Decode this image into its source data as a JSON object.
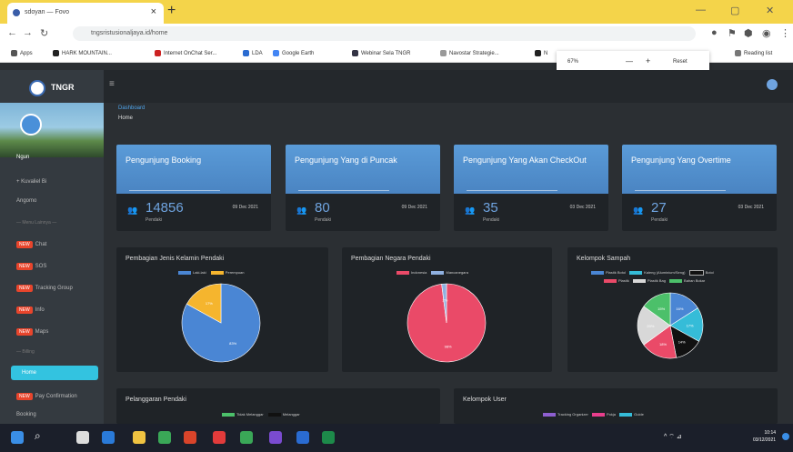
{
  "browser": {
    "tab_title": "sdoyan — Fovo",
    "url": "tngsristusionaljaya.id/home",
    "bookmarks": [
      "Apps",
      "HARK MOUNTAIN...",
      "Internet OnChat Ser...",
      "LDA",
      "Google Earth",
      "Webinar Sela TNGR",
      "Navostar Strategie...",
      "N"
    ],
    "zoom": {
      "value": "67%",
      "minus": "—",
      "plus": "+",
      "reset": "Reset"
    },
    "more_bookmarks": "Reading list"
  },
  "app": {
    "brand": "TNGR",
    "breadcrumb": [
      "Dashboard",
      "Home"
    ],
    "user": "Ngun",
    "sidebar": {
      "items": [
        {
          "label": "+ Kuvaliel Bi",
          "badge": ""
        },
        {
          "label": "Angomo",
          "badge": ""
        },
        {
          "label": "Chat",
          "badge": "NEW"
        },
        {
          "label": "SOS",
          "badge": "NEW"
        },
        {
          "label": "Tracking Group",
          "badge": "NEW"
        },
        {
          "label": "Info",
          "badge": "NEW"
        },
        {
          "label": "Maps",
          "badge": "NEW"
        }
      ],
      "header_1": "— Menu Lainnya —",
      "header_2": "— Billing",
      "active": "Home",
      "bottom_items": [
        {
          "label": "Pay Confirmation",
          "badge": "NEW"
        },
        {
          "label": "Booking",
          "badge": ""
        }
      ]
    },
    "cards": [
      {
        "title": "Pengunjung Booking",
        "value": "14856",
        "unit": "Pendaki",
        "date": "09 Dec 2021"
      },
      {
        "title": "Pengunjung Yang di Puncak",
        "value": "80",
        "unit": "Pendaki",
        "date": "09 Dec 2021"
      },
      {
        "title": "Pengunjung Yang Akan CheckOut",
        "value": "35",
        "unit": "Pendaki",
        "date": "03 Dec 2021"
      },
      {
        "title": "Pengunjung Yang Overtime",
        "value": "27",
        "unit": "Pendaki",
        "date": "03 Dec 2021"
      }
    ],
    "panels": {
      "gender": {
        "title": "Pembagian Jenis Kelamin Pendaki",
        "legend": [
          "Laki-laki",
          "Perempuan"
        ]
      },
      "country": {
        "title": "Pembagian Negara Pendaki",
        "legend": [
          "Indonesia",
          "Mancanegara"
        ]
      },
      "trash": {
        "title": "Kelompok Sampah",
        "legend": [
          "Plastik Botol",
          "Kaleng (Aluminium/Seng)",
          "Botol",
          "Plastik",
          "Plastik Bag",
          "Bahan Bokar"
        ]
      },
      "violations": {
        "title": "Pelanggaran Pendaki",
        "legend": [
          "Tidak Melanggar",
          "Melanggar"
        ]
      },
      "users": {
        "title": "Kelompok User",
        "legend": [
          "Tracking Organizer",
          "Pokja",
          "Guide"
        ]
      }
    }
  },
  "chart_data": [
    {
      "type": "pie",
      "title": "Pembagian Jenis Kelamin Pendaki",
      "categories": [
        "Laki-laki",
        "Perempuan"
      ],
      "values": [
        83,
        17
      ],
      "labels": [
        "83%",
        "17%"
      ],
      "colors": [
        "#4a86d4",
        "#f5b52e"
      ],
      "legend": "top"
    },
    {
      "type": "pie",
      "title": "Pembagian Negara Pendaki",
      "categories": [
        "Indonesia",
        "Mancanegara"
      ],
      "values": [
        98,
        2
      ],
      "labels": [
        "98%",
        "2%"
      ],
      "colors": [
        "#ea4a68",
        "#8fb0e0"
      ],
      "legend": "top"
    },
    {
      "type": "pie",
      "title": "Kelompok Sampah",
      "categories": [
        "Plastik Botol",
        "Kaleng (Aluminium/Seng)",
        "Botol",
        "Plastik",
        "Plastik Bag",
        "Bahan Bokar"
      ],
      "values": [
        16,
        17,
        14,
        18,
        20,
        15
      ],
      "labels": [
        "16%",
        "17%",
        "14%",
        "18%",
        "20%",
        "15%"
      ],
      "colors": [
        "#4a86d4",
        "#35bcd8",
        "#111111",
        "#ea4a68",
        "#d8d8d8",
        "#4cc06a"
      ],
      "legend": "top"
    }
  ],
  "taskbar": {
    "time": "10:14",
    "date": "03/12/2021",
    "tray": "^  ⌔  ⊿"
  }
}
